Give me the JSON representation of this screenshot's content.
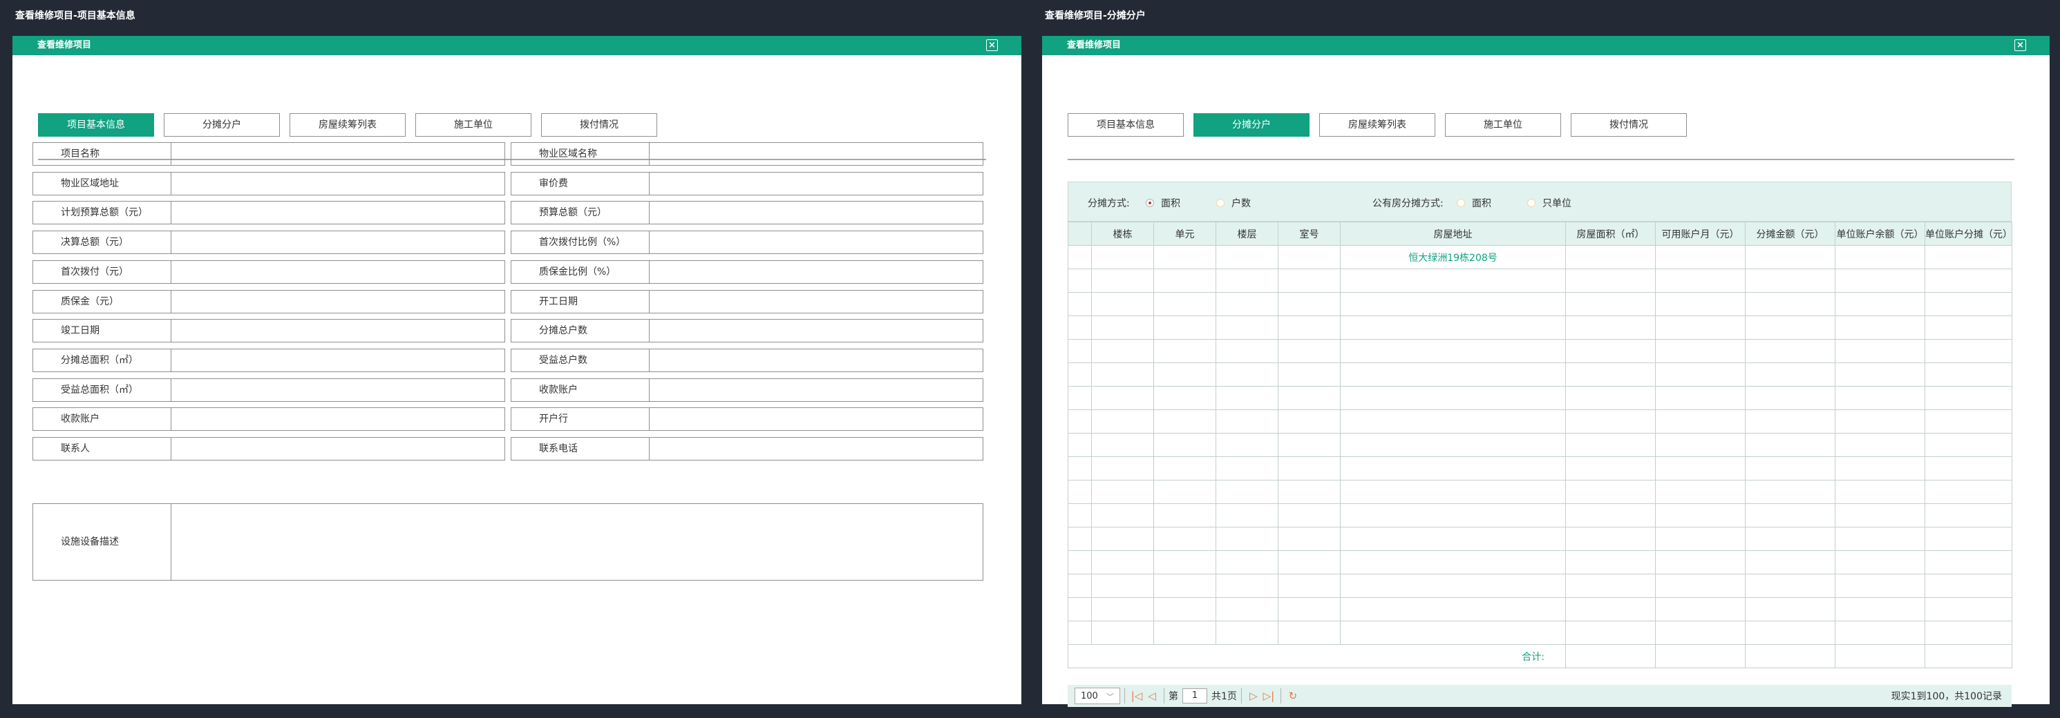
{
  "left": {
    "screen_title": "查看维修项目-项目基本信息",
    "panel_title": "查看维修项目",
    "close_icon": "×",
    "tabs": [
      {
        "label": "项目基本信息",
        "active": true
      },
      {
        "label": "分摊分户",
        "active": false
      },
      {
        "label": "房屋续筹列表",
        "active": false
      },
      {
        "label": "施工单位",
        "active": false
      },
      {
        "label": "拨付情况",
        "active": false
      }
    ],
    "form_rows": [
      [
        "项目名称",
        "物业区域名称"
      ],
      [
        "物业区域地址",
        "审价费"
      ],
      [
        "计划预算总额（元）",
        "预算总额（元）"
      ],
      [
        "决算总额（元）",
        "首次拨付比例（%）"
      ],
      [
        "首次拨付（元）",
        "质保金比例（%）"
      ],
      [
        "质保金（元）",
        "开工日期"
      ],
      [
        "竣工日期",
        "分摊总户数"
      ],
      [
        "分摊总面积（㎡）",
        "受益总户数"
      ],
      [
        "受益总面积（㎡）",
        "收款账户"
      ],
      [
        "收款账户",
        "开户行"
      ],
      [
        "联系人",
        "联系电话"
      ]
    ],
    "description_label": "设施设备描述"
  },
  "right": {
    "screen_title": "查看维修项目-分摊分户",
    "panel_title": "查看维修项目",
    "close_icon": "×",
    "tabs": [
      {
        "label": "项目基本信息",
        "active": false
      },
      {
        "label": "分摊分户",
        "active": true
      },
      {
        "label": "房屋续筹列表",
        "active": false
      },
      {
        "label": "施工单位",
        "active": false
      },
      {
        "label": "拨付情况",
        "active": false
      }
    ],
    "alloc_label": "分摊方式:",
    "alloc_options": [
      "面积",
      "户数"
    ],
    "public_label": "公有房分摊方式:",
    "public_options": [
      "面积",
      "只单位"
    ],
    "columns": [
      "",
      "楼栋",
      "单元",
      "楼层",
      "室号",
      "房屋地址",
      "房屋面积（㎡）",
      "可用账户月（元）",
      "分摊金额（元）",
      "单位账户余额（元）",
      "单位账户分摊（元）"
    ],
    "first_row_address": "恒大绿洲19栋208号",
    "total_label": "合计:",
    "pager": {
      "page_size": "100",
      "page_prefix": "第",
      "page_number": "1",
      "page_total": "共1页",
      "record_info": "现实1到100，共100记录"
    }
  },
  "colors": {
    "accent": "#10a281",
    "background": "#232a36",
    "light_accent": "#e2f2ee",
    "pager_icon": "#e8764f"
  }
}
